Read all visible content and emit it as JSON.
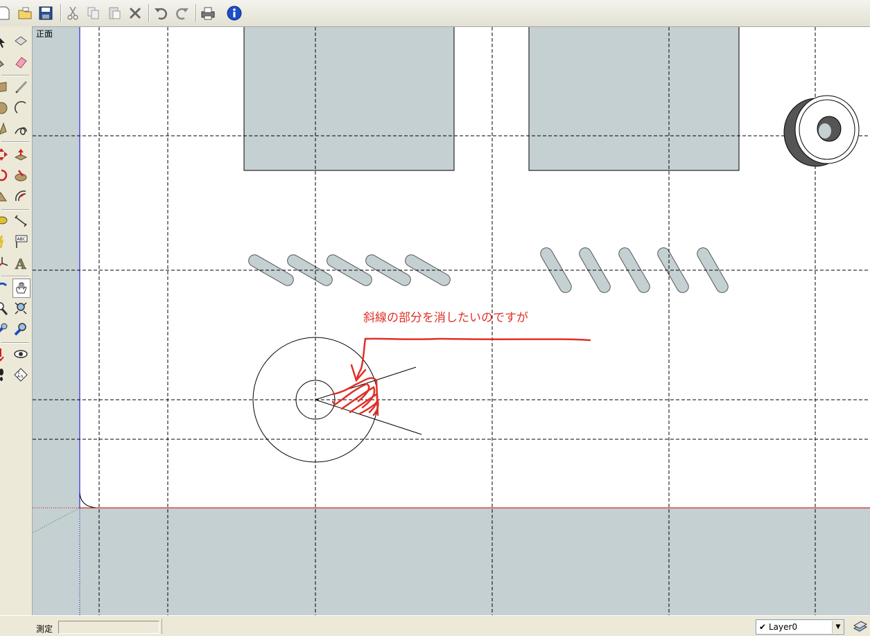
{
  "view": {
    "label": "正面"
  },
  "annotation": {
    "text": "斜線の部分を消したいのですが"
  },
  "status": {
    "measure_label": "測定",
    "measure_value": ""
  },
  "layer": {
    "check": "✔",
    "name": "Layer0",
    "arrow": "▼"
  },
  "colors": {
    "drawing_fill": "#c5d0d3",
    "annotation_red": "#e03028",
    "guide_line": "#000000",
    "axis_red": "#c00000",
    "axis_blue": "#0000cc",
    "axis_green": "#2a9a2a"
  },
  "toolbar_top": [
    "new-file-icon",
    "open-folder-icon",
    "save-icon",
    "cut-icon",
    "copy-icon",
    "paste-icon",
    "delete-icon",
    "undo-icon",
    "redo-icon",
    "print-icon",
    "info-icon"
  ],
  "toolbar_left": [
    "select-icon",
    "make-component-icon",
    "paint-bucket-icon",
    "eraser-icon",
    "rectangle-icon",
    "line-icon",
    "circle-icon",
    "arc-icon",
    "polygon-icon",
    "freehand-icon",
    "move-icon",
    "push-pull-icon",
    "rotate-icon",
    "follow-me-icon",
    "scale-icon",
    "offset-icon",
    "tape-measure-icon",
    "dimension-icon",
    "protractor-icon",
    "text-icon",
    "axes-icon",
    "3d-text-icon",
    "orbit-icon",
    "pan-icon",
    "zoom-icon",
    "zoom-window-icon",
    "zoom-extents-icon",
    "previous-view-icon",
    "position-camera-icon",
    "look-around-icon",
    "walk-icon",
    "section-plane-icon"
  ]
}
